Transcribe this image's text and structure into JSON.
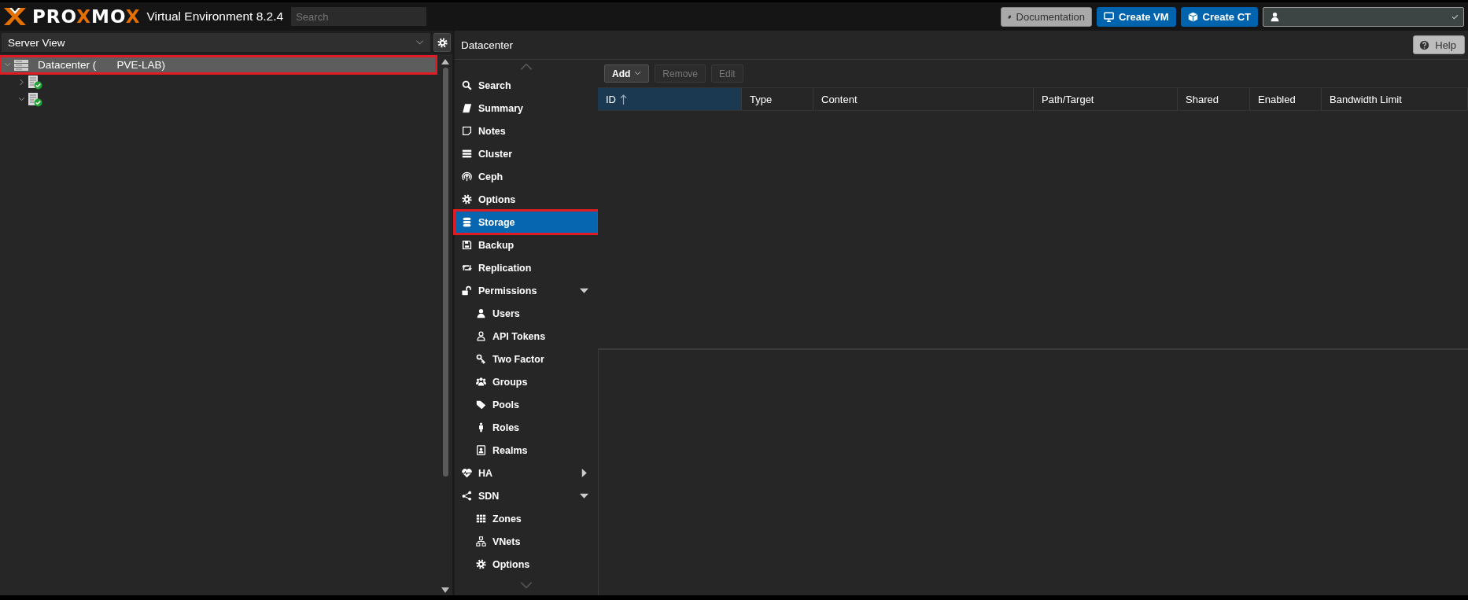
{
  "topbar": {
    "logo": "PROXMOX",
    "product": "Virtual Environment 8.2.4",
    "search": {
      "placeholder": "Search"
    },
    "buttons": [
      {
        "label": "Documentation",
        "kind": "secondary"
      },
      {
        "label": "Create VM",
        "kind": "primary"
      },
      {
        "label": "Create CT",
        "kind": "primary"
      }
    ]
  },
  "sidebar": {
    "view": "Server View",
    "tree": [
      {
        "label": "Datacenter (       PVE-LAB)",
        "expanded": true,
        "selected": true,
        "highlighted": true,
        "children": [
          {
            "expanded": false,
            "selected": false,
            "highlighted": false,
            "online": true
          },
          {
            "expanded": true,
            "selected": false,
            "highlighted": false,
            "online": true
          }
        ]
      }
    ]
  },
  "content": {
    "title": "Datacenter",
    "help": "Help",
    "nav": [
      {
        "label": "Search",
        "selected": false,
        "highlighted": false
      },
      {
        "label": "Summary",
        "selected": false,
        "highlighted": false
      },
      {
        "label": "Notes",
        "selected": false,
        "highlighted": false
      },
      {
        "label": "Cluster",
        "selected": false,
        "highlighted": false
      },
      {
        "label": "Ceph",
        "selected": false,
        "highlighted": false
      },
      {
        "label": "Options",
        "selected": false,
        "highlighted": false
      },
      {
        "label": "Storage",
        "selected": true,
        "highlighted": true
      },
      {
        "label": "Backup",
        "selected": false,
        "highlighted": false
      },
      {
        "label": "Replication",
        "selected": false,
        "highlighted": false
      },
      {
        "label": "Permissions",
        "selected": false,
        "highlighted": false,
        "expanded": true,
        "children": [
          {
            "label": "Users",
            "selected": false,
            "highlighted": false
          },
          {
            "label": "API Tokens",
            "selected": false,
            "highlighted": false
          },
          {
            "label": "Two Factor",
            "selected": false,
            "highlighted": false
          },
          {
            "label": "Groups",
            "selected": false,
            "highlighted": false
          },
          {
            "label": "Pools",
            "selected": false,
            "highlighted": false
          },
          {
            "label": "Roles",
            "selected": false,
            "highlighted": false
          },
          {
            "label": "Realms",
            "selected": false,
            "highlighted": false
          }
        ]
      },
      {
        "label": "HA",
        "selected": false,
        "highlighted": false,
        "expanded": false
      },
      {
        "label": "SDN",
        "selected": false,
        "highlighted": false,
        "expanded": true,
        "children": [
          {
            "label": "Zones",
            "selected": false,
            "highlighted": false
          },
          {
            "label": "VNets",
            "selected": false,
            "highlighted": false
          },
          {
            "label": "Options",
            "selected": false,
            "highlighted": false
          }
        ]
      }
    ],
    "toolbar": [
      {
        "label": "Add",
        "kind": "menu",
        "disabled": false
      },
      {
        "label": "Remove",
        "kind": "plain",
        "disabled": true
      },
      {
        "label": "Edit",
        "kind": "plain",
        "disabled": true
      }
    ],
    "table": {
      "columns": [
        {
          "label": "ID",
          "sorted": true
        },
        {
          "label": "Type",
          "sorted": false
        },
        {
          "label": "Content",
          "sorted": false
        },
        {
          "label": "Path/Target",
          "sorted": false
        },
        {
          "label": "Shared",
          "sorted": false
        },
        {
          "label": "Enabled",
          "sorted": false
        },
        {
          "label": "Bandwidth Limit",
          "sorted": false
        }
      ]
    }
  }
}
